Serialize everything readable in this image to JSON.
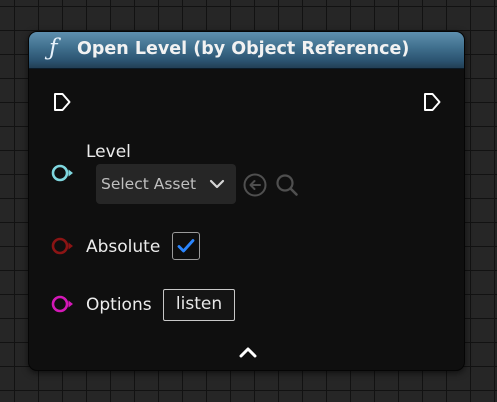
{
  "node": {
    "icon": "function-icon",
    "title": "Open Level (by Object Reference)"
  },
  "exec": {
    "input_icon": "exec-input-pin-icon",
    "output_icon": "exec-output-pin-icon"
  },
  "pins": {
    "level": {
      "label": "Level",
      "color": "#7fd7df",
      "asset_select_label": "Select Asset",
      "dropdown_icon": "chevron-down-icon",
      "use_selected_icon": "arrow-left-circle-icon",
      "browse_icon": "search-icon"
    },
    "absolute": {
      "label": "Absolute",
      "color": "#8b1414",
      "checked": true,
      "check_color": "#2b86ff"
    },
    "options": {
      "label": "Options",
      "color": "#d418b7",
      "value": "listen"
    }
  },
  "footer": {
    "collapse_icon": "chevron-up-icon"
  },
  "colors": {
    "header_blue": "#3f6e8c",
    "node_body": "#0f0f0f",
    "grid_background": "#262626"
  }
}
